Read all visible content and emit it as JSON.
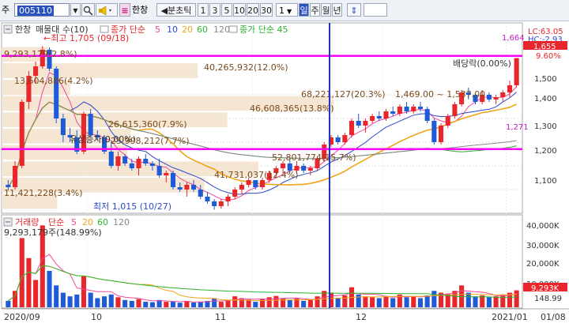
{
  "toolbar": {
    "menu_label": "주",
    "code_value": "005110",
    "search_icon": "magnifier-icon",
    "speaker_icon": "speaker-icon",
    "stock_name": "한창",
    "period_tabs": [
      "분초틱",
      "1",
      "3",
      "5",
      "10",
      "20",
      "30"
    ],
    "day_tab": "일",
    "week_tab": "주",
    "month_tab": "월",
    "year_tab": "년",
    "count_value": "1",
    "updown_icon": "up-down-arrows-icon"
  },
  "price_pane": {
    "title_name": "한창",
    "indicator_label": "매물대 수(10)",
    "ma_title": "종가 단순",
    "ma_periods": [
      "5",
      "10",
      "20",
      "60",
      "120"
    ],
    "ma2_title": "종가 단순 45",
    "lc_label": "LC:63.05",
    "hc_label": "HC:-2.93",
    "change_label": "9.60%",
    "last_price_label": "1,655",
    "level_label_1664": "1,664",
    "level_label_1271": "1,271",
    "annotations": {
      "high": "←최고 1,705 (09/18)",
      "low": "최저 1,015 (10/27)",
      "dividend": "배당락(0.00%)",
      "rights": "유상증자(0.00%)"
    },
    "volume_profile_labels": [
      "9,293,179(2.8%)",
      "40,265,932(12.0%)",
      "13,604,886(4.2%)",
      "68,221,127(20.3%)",
      "1,469.00 ~ 1,537.00",
      "46,608,365(13.8%)",
      "26,615,360(7.9%)",
      "25,998,212(7.7%)",
      "52,801,774(15.7%)",
      "41,731,037(12.4%)",
      "11,421,228(3.4%)"
    ]
  },
  "volume_pane": {
    "title": "거래량",
    "ma_title": "단순",
    "ma_periods": [
      "5",
      "20",
      "60",
      "120"
    ],
    "current_label": "9,293,179주(148.99%)",
    "last_volume_label": "9,293K",
    "last_pct_label": "148.99"
  },
  "x_axis_labels": [
    "2020/09",
    "10",
    "11",
    "12",
    "2021/01",
    "01/08"
  ],
  "price_axis_labels": [
    "1,500",
    "1,400",
    "1,300",
    "1,200",
    "1,100"
  ],
  "volume_axis_labels": [
    "40,000K",
    "30,000K",
    "20,000K",
    "10,000K"
  ],
  "colors": {
    "up": "#e8262b",
    "down": "#1f5bd6",
    "ma5": "#f0489a",
    "ma10": "#2b49c9",
    "ma20": "#f0a419",
    "ma60": "#2cb52c",
    "ma120": "#888888",
    "magenta_line": "#ff00ff",
    "profile": "#f3e2cc"
  },
  "chart_data": {
    "type": "candlestick",
    "title": "한창",
    "ylim": [
      1010,
      1710
    ],
    "volume_ylim": [
      0,
      46000
    ],
    "horizontal_levels": [
      1664,
      1271
    ],
    "x_labels": [
      "2020/09",
      "10",
      "11",
      "12",
      "2021/01",
      "01/08"
    ],
    "candles": [
      [
        1120,
        1140,
        1095,
        1110
      ],
      [
        1110,
        1220,
        1100,
        1200
      ],
      [
        1200,
        1480,
        1190,
        1470
      ],
      [
        1470,
        1600,
        1440,
        1580
      ],
      [
        1580,
        1640,
        1550,
        1620
      ],
      [
        1620,
        1705,
        1610,
        1690
      ],
      [
        1690,
        1700,
        1600,
        1610
      ],
      [
        1610,
        1620,
        1380,
        1400
      ],
      [
        1400,
        1420,
        1300,
        1330
      ],
      [
        1330,
        1360,
        1300,
        1320
      ],
      [
        1320,
        1350,
        1250,
        1260
      ],
      [
        1260,
        1430,
        1250,
        1420
      ],
      [
        1420,
        1440,
        1320,
        1330
      ],
      [
        1330,
        1350,
        1310,
        1320
      ],
      [
        1320,
        1330,
        1250,
        1260
      ],
      [
        1260,
        1300,
        1190,
        1200
      ],
      [
        1200,
        1260,
        1180,
        1240
      ],
      [
        1240,
        1250,
        1200,
        1210
      ],
      [
        1210,
        1230,
        1180,
        1190
      ],
      [
        1190,
        1240,
        1160,
        1230
      ],
      [
        1230,
        1250,
        1200,
        1210
      ],
      [
        1210,
        1220,
        1180,
        1200
      ],
      [
        1200,
        1230,
        1150,
        1160
      ],
      [
        1160,
        1180,
        1130,
        1170
      ],
      [
        1170,
        1180,
        1100,
        1110
      ],
      [
        1110,
        1130,
        1090,
        1100
      ],
      [
        1100,
        1130,
        1070,
        1120
      ],
      [
        1120,
        1140,
        1090,
        1100
      ],
      [
        1100,
        1120,
        1060,
        1070
      ],
      [
        1070,
        1090,
        1040,
        1050
      ],
      [
        1050,
        1060,
        1015,
        1030
      ],
      [
        1030,
        1060,
        1020,
        1050
      ],
      [
        1050,
        1080,
        1030,
        1070
      ],
      [
        1070,
        1110,
        1060,
        1100
      ],
      [
        1100,
        1130,
        1080,
        1120
      ],
      [
        1120,
        1150,
        1110,
        1140
      ],
      [
        1140,
        1130,
        1100,
        1110
      ],
      [
        1110,
        1150,
        1100,
        1140
      ],
      [
        1140,
        1180,
        1130,
        1170
      ],
      [
        1170,
        1200,
        1150,
        1190
      ],
      [
        1190,
        1220,
        1170,
        1210
      ],
      [
        1210,
        1230,
        1170,
        1180
      ],
      [
        1180,
        1220,
        1170,
        1200
      ],
      [
        1200,
        1210,
        1170,
        1180
      ],
      [
        1180,
        1200,
        1160,
        1190
      ],
      [
        1190,
        1240,
        1180,
        1230
      ],
      [
        1230,
        1300,
        1220,
        1290
      ],
      [
        1290,
        1330,
        1280,
        1320
      ],
      [
        1320,
        1330,
        1290,
        1300
      ],
      [
        1300,
        1340,
        1290,
        1330
      ],
      [
        1330,
        1400,
        1320,
        1390
      ],
      [
        1390,
        1420,
        1360,
        1370
      ],
      [
        1370,
        1400,
        1340,
        1390
      ],
      [
        1390,
        1420,
        1380,
        1410
      ],
      [
        1410,
        1430,
        1390,
        1400
      ],
      [
        1400,
        1440,
        1390,
        1430
      ],
      [
        1430,
        1450,
        1410,
        1420
      ],
      [
        1420,
        1460,
        1410,
        1450
      ],
      [
        1450,
        1470,
        1420,
        1430
      ],
      [
        1430,
        1460,
        1420,
        1450
      ],
      [
        1450,
        1470,
        1430,
        1440
      ],
      [
        1440,
        1450,
        1380,
        1390
      ],
      [
        1390,
        1400,
        1290,
        1300
      ],
      [
        1300,
        1380,
        1290,
        1370
      ],
      [
        1370,
        1420,
        1360,
        1410
      ],
      [
        1410,
        1470,
        1400,
        1460
      ],
      [
        1460,
        1520,
        1450,
        1510
      ],
      [
        1510,
        1530,
        1480,
        1500
      ],
      [
        1500,
        1510,
        1460,
        1470
      ],
      [
        1470,
        1520,
        1460,
        1500
      ],
      [
        1500,
        1510,
        1470,
        1480
      ],
      [
        1480,
        1500,
        1460,
        1490
      ],
      [
        1490,
        1520,
        1470,
        1510
      ],
      [
        1510,
        1560,
        1490,
        1540
      ],
      [
        1540,
        1650,
        1530,
        1655
      ]
    ],
    "volume": [
      3500,
      9000,
      38000,
      27000,
      15000,
      45000,
      20000,
      12000,
      8000,
      6000,
      7000,
      17000,
      8000,
      5000,
      6000,
      7000,
      5500,
      4000,
      3500,
      4500,
      3000,
      2800,
      4000,
      3000,
      3200,
      2500,
      3500,
      2600,
      3000,
      3500,
      5000,
      3000,
      4000,
      6000,
      5000,
      4200,
      3000,
      4500,
      5500,
      6200,
      5000,
      4000,
      4800,
      3500,
      4200,
      6000,
      9000,
      8000,
      5000,
      6500,
      11000,
      7000,
      6000,
      5500,
      5000,
      6200,
      5000,
      7000,
      5500,
      6000,
      5000,
      6500,
      9000,
      8000,
      7500,
      9000,
      12000,
      8000,
      6000,
      6500,
      5500,
      6000,
      7000,
      8000,
      9293
    ]
  }
}
